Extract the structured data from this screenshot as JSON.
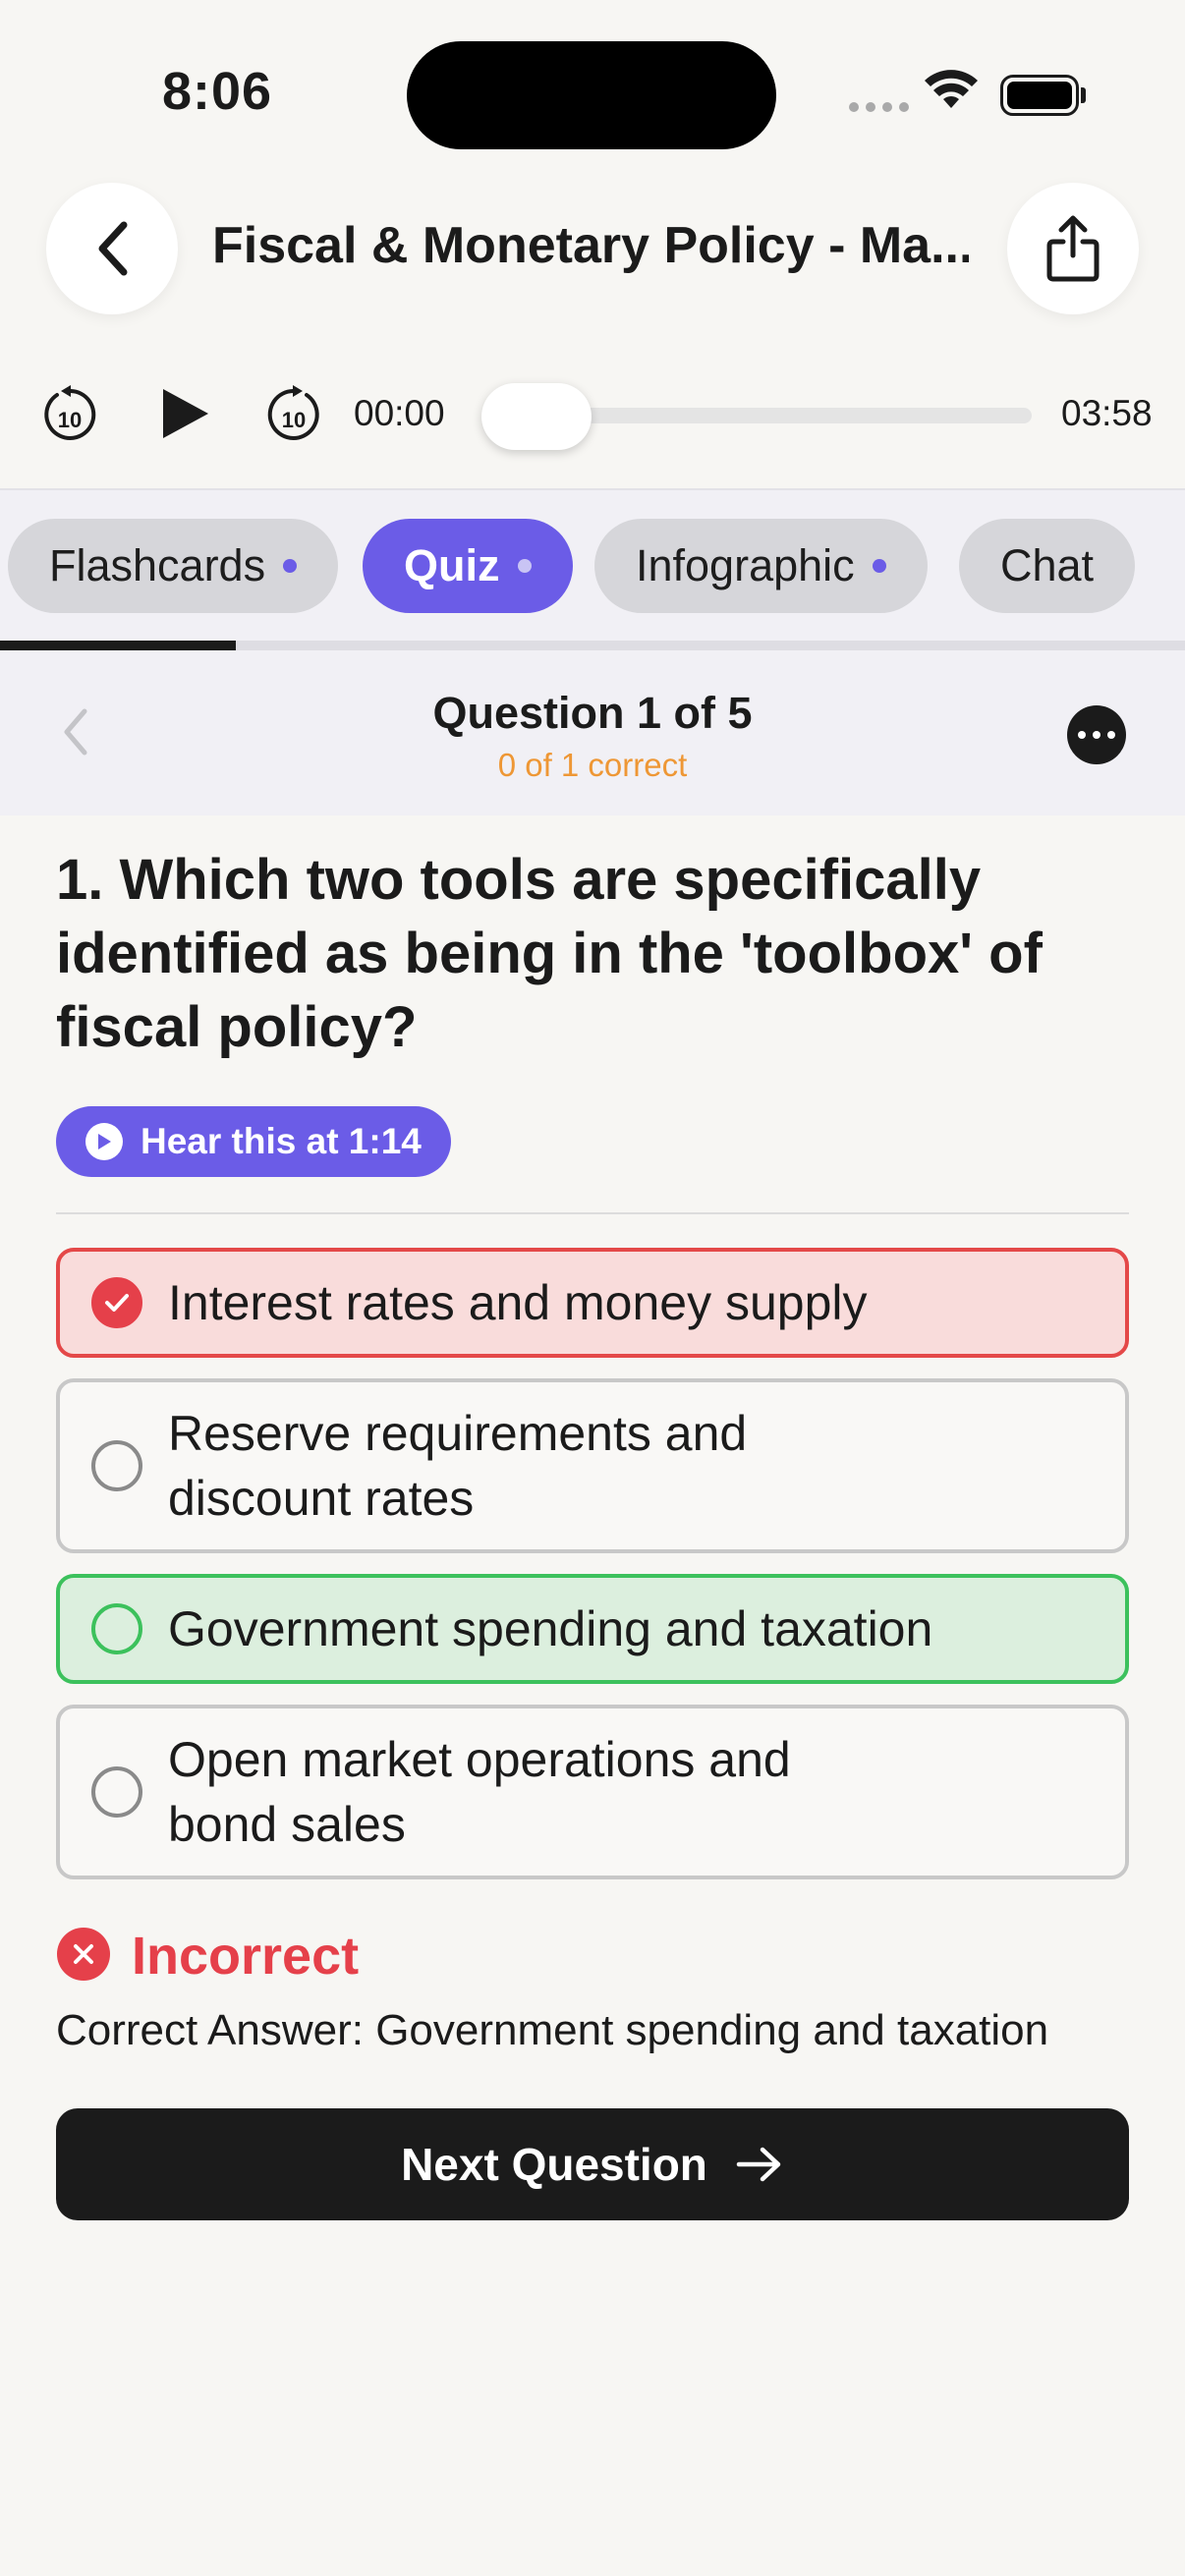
{
  "status_bar": {
    "time": "8:06"
  },
  "header": {
    "title": "Fiscal & Monetary Policy - Ma..."
  },
  "player": {
    "current_time": "00:00",
    "duration": "03:58",
    "progress": 0
  },
  "tabs": [
    {
      "label": "Flashcards",
      "active": false
    },
    {
      "label": "Quiz",
      "active": true
    },
    {
      "label": "Infographic",
      "active": false
    },
    {
      "label": "Chat",
      "active": false
    }
  ],
  "quiz": {
    "counter": "Question 1 of 5",
    "score": "0 of 1 correct",
    "question": "1. Which two tools are specifically identified as being in the 'toolbox' of fiscal policy?",
    "hear_label": "Hear this at 1:14",
    "options": [
      {
        "label": "Interest rates and money supply",
        "state": "selected-incorrect"
      },
      {
        "label": "Reserve requirements and discount rates",
        "state": "neutral"
      },
      {
        "label": "Government spending and taxation",
        "state": "correct"
      },
      {
        "label": "Open market operations and bond sales",
        "state": "neutral"
      }
    ],
    "result_label": "Incorrect",
    "result_detail": "Correct Answer: Government spending and taxation",
    "next_label": "Next Question"
  },
  "colors": {
    "accent": "#6b5ce7",
    "error": "#e5404a",
    "success": "#3cc15c",
    "score": "#ee9735"
  }
}
